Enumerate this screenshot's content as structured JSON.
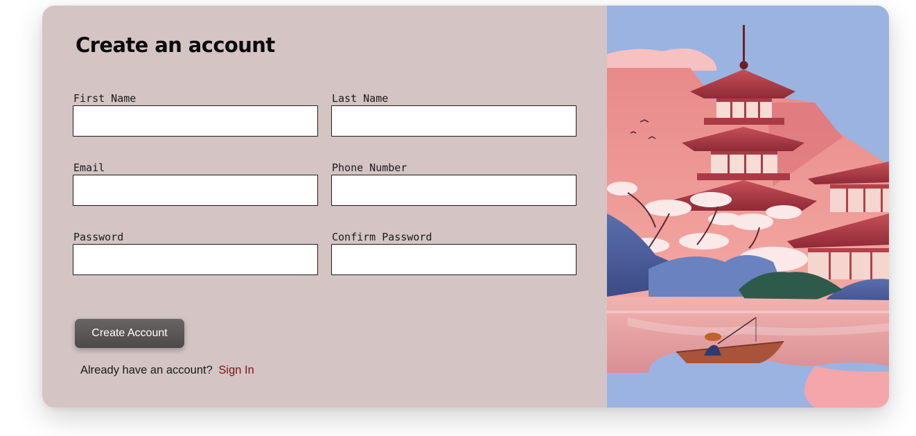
{
  "form": {
    "title": "Create an account",
    "fields": [
      {
        "label": "First Name",
        "value": "",
        "placeholder": ""
      },
      {
        "label": "Last Name",
        "value": "",
        "placeholder": ""
      },
      {
        "label": "Email",
        "value": "",
        "placeholder": ""
      },
      {
        "label": "Phone Number",
        "value": "",
        "placeholder": ""
      },
      {
        "label": "Password",
        "value": "",
        "placeholder": ""
      },
      {
        "label": "Confirm Password",
        "value": "",
        "placeholder": ""
      }
    ],
    "submit_label": "Create Account",
    "signin_prompt": "Already have an account?",
    "signin_link": "Sign In"
  },
  "colors": {
    "panel_bg": "#d4c4c4",
    "button_bg": "#5a5656",
    "link": "#7a1414",
    "sky": "#9bb3e0",
    "pagoda": "#b0424c"
  },
  "illustration": {
    "subject": "japanese-pagoda-landscape"
  }
}
